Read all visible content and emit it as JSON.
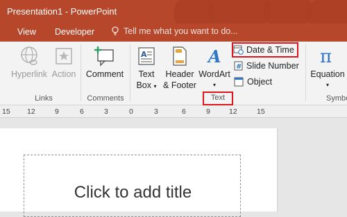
{
  "window": {
    "title": "Presentation1 - PowerPoint"
  },
  "tabs": [
    {
      "label": "View"
    },
    {
      "label": "Developer"
    }
  ],
  "tell_me": {
    "placeholder": "Tell me what you want to do..."
  },
  "ribbon": {
    "groups": {
      "links": {
        "label": "Links",
        "hyperlink": "Hyperlink",
        "action": "Action"
      },
      "comments": {
        "label": "Comments",
        "comment": "Comment"
      },
      "text": {
        "label": "Text",
        "text_box": [
          "Text",
          "Box"
        ],
        "header_footer": [
          "Header",
          "& Footer"
        ],
        "wordart": "WordArt",
        "date_time": "Date & Time",
        "slide_number": "Slide Number",
        "object": "Object"
      },
      "symbols": {
        "label": "Symbo",
        "equation": "Equation"
      }
    }
  },
  "ruler": {
    "marks": [
      "15",
      "12",
      "9",
      "6",
      "3",
      "0",
      "3",
      "6",
      "9",
      "12",
      "15"
    ]
  },
  "slide": {
    "title_placeholder": "Click to add title"
  },
  "colors": {
    "accent": "#b7472a",
    "highlight": "#e2141b"
  }
}
